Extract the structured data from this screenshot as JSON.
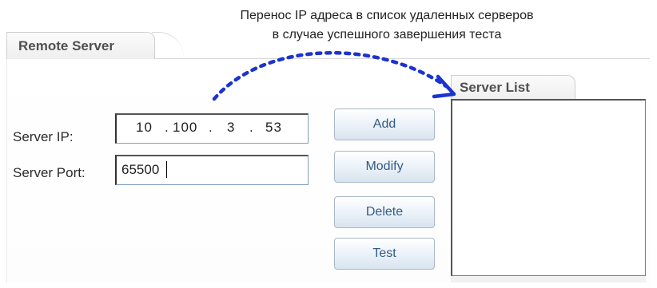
{
  "annotation": {
    "line1": "Перенос IP адреса  в список удаленных серверов",
    "line2": "в случае успешного завершения теста"
  },
  "remote_server": {
    "tab_label": "Remote Server",
    "server_ip_label": "Server IP:",
    "server_ip_octets": [
      "10",
      "100",
      "3",
      "53"
    ],
    "server_port_label": "Server Port:",
    "server_port_value": "65500"
  },
  "buttons": {
    "add": "Add",
    "modify": "Modify",
    "delete": "Delete",
    "test": "Test"
  },
  "server_list": {
    "tab_label": "Server List",
    "items": []
  },
  "colors": {
    "arrow": "#1c34cc",
    "button_text": "#345a86"
  },
  "icons": {
    "transfer_arrow": "dotted-curved-arrow-icon"
  }
}
